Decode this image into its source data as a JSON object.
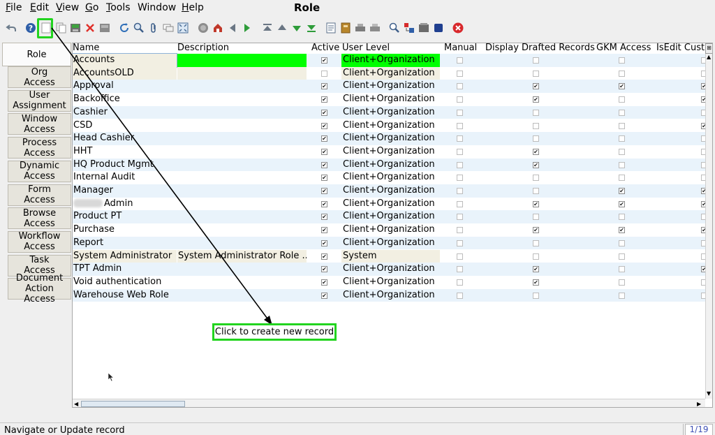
{
  "window_title": "Role",
  "menu": [
    {
      "mn": "F",
      "rest": "ile"
    },
    {
      "mn": "E",
      "rest": "dit"
    },
    {
      "mn": "V",
      "rest": "iew"
    },
    {
      "mn": "G",
      "rest": "o"
    },
    {
      "mn": "T",
      "rest": "ools"
    },
    {
      "mn": "W",
      "rest": "indow",
      "plain": true
    },
    {
      "mn": "H",
      "rest": "elp"
    }
  ],
  "tabs": [
    "Role",
    "Org\nAccess",
    "User\nAssignment",
    "Window\nAccess",
    "Process\nAccess",
    "Dynamic\nAccess",
    "Form\nAccess",
    "Browse\nAccess",
    "Workflow\nAccess",
    "Task\nAccess",
    "Document\nAction Access"
  ],
  "columns": {
    "name": "Name",
    "description": "Description",
    "active": "Active",
    "user_level": "User Level",
    "manual": "Manual",
    "display_drafted": "Display Drafted Records",
    "gkm_access": "GKM Access",
    "isedit": "IsEdit Custo"
  },
  "rows": [
    {
      "name": "Accounts",
      "description": "",
      "active": true,
      "user_level": "Client+Organization",
      "manual": false,
      "drafted": false,
      "gkm": false,
      "isedit": false,
      "selected": true
    },
    {
      "name": "AccountsOLD",
      "description": "",
      "active": false,
      "user_level": "Client+Organization",
      "manual": false,
      "drafted": false,
      "gkm": false,
      "isedit": false
    },
    {
      "name": "Approval",
      "description": "",
      "active": true,
      "user_level": "Client+Organization",
      "manual": false,
      "drafted": true,
      "gkm": true,
      "isedit": true
    },
    {
      "name": "Backoffice",
      "description": "",
      "active": true,
      "user_level": "Client+Organization",
      "manual": false,
      "drafted": true,
      "gkm": false,
      "isedit": true
    },
    {
      "name": "Cashier",
      "description": "",
      "active": true,
      "user_level": "Client+Organization",
      "manual": false,
      "drafted": false,
      "gkm": false,
      "isedit": false
    },
    {
      "name": "CSD",
      "description": "",
      "active": true,
      "user_level": "Client+Organization",
      "manual": false,
      "drafted": false,
      "gkm": false,
      "isedit": true
    },
    {
      "name": "Head Cashier",
      "description": "",
      "active": true,
      "user_level": "Client+Organization",
      "manual": false,
      "drafted": false,
      "gkm": false,
      "isedit": false
    },
    {
      "name": "HHT",
      "description": "",
      "active": true,
      "user_level": "Client+Organization",
      "manual": false,
      "drafted": true,
      "gkm": false,
      "isedit": false
    },
    {
      "name": "HQ Product Mgmt",
      "description": "",
      "active": true,
      "user_level": "Client+Organization",
      "manual": false,
      "drafted": true,
      "gkm": false,
      "isedit": false
    },
    {
      "name": "Internal Audit",
      "description": "",
      "active": true,
      "user_level": "Client+Organization",
      "manual": false,
      "drafted": false,
      "gkm": false,
      "isedit": false
    },
    {
      "name": "Manager",
      "description": "",
      "active": true,
      "user_level": "Client+Organization",
      "manual": false,
      "drafted": false,
      "gkm": true,
      "isedit": true
    },
    {
      "name": "Admin",
      "description": "",
      "active": true,
      "user_level": "Client+Organization",
      "manual": false,
      "drafted": true,
      "gkm": true,
      "isedit": true,
      "blurred_prefix": true
    },
    {
      "name": "Product PT",
      "description": "",
      "active": true,
      "user_level": "Client+Organization",
      "manual": false,
      "drafted": false,
      "gkm": false,
      "isedit": false
    },
    {
      "name": "Purchase",
      "description": "",
      "active": true,
      "user_level": "Client+Organization",
      "manual": false,
      "drafted": true,
      "gkm": true,
      "isedit": true
    },
    {
      "name": "Report",
      "description": "",
      "active": true,
      "user_level": "Client+Organization",
      "manual": false,
      "drafted": false,
      "gkm": false,
      "isedit": false
    },
    {
      "name": "System Administrator",
      "description": "System Administrator Role ...",
      "active": true,
      "user_level": "System",
      "manual": false,
      "drafted": false,
      "gkm": false,
      "isedit": false
    },
    {
      "name": "TPT Admin",
      "description": "",
      "active": true,
      "user_level": "Client+Organization",
      "manual": false,
      "drafted": true,
      "gkm": false,
      "isedit": true
    },
    {
      "name": "Void authentication",
      "description": "",
      "active": true,
      "user_level": "Client+Organization",
      "manual": false,
      "drafted": true,
      "gkm": false,
      "isedit": false
    },
    {
      "name": "Warehouse Web Role",
      "description": "",
      "active": true,
      "user_level": "Client+Organization",
      "manual": false,
      "drafted": false,
      "gkm": false,
      "isedit": false
    }
  ],
  "callout": "Click to create new record",
  "status": {
    "message": "Navigate or Update record",
    "record_count": "1/19"
  },
  "colors": {
    "highlight_green": "#22d41f",
    "required_field": "#00ff00",
    "readonly_field": "#f2efe2",
    "alt_row": "#e9f3fb"
  },
  "toolbar_icons": [
    "undo-icon",
    "help-icon",
    "new-record-icon",
    "copy-record-icon",
    "save-icon",
    "delete-icon",
    "save-disabled-icon",
    "refresh-icon",
    "find-icon",
    "attachment-icon",
    "chat-icon",
    "grid-toggle-icon",
    "history-icon",
    "home-icon",
    "back-icon",
    "forward-icon",
    "first-record-icon",
    "previous-record-icon",
    "next-record-icon",
    "last-record-icon",
    "report-icon",
    "archive-icon",
    "print-icon",
    "print-preview-icon",
    "zoom-across-icon",
    "request-icon",
    "product-info-icon",
    "workflow-icon",
    "close-window-icon"
  ]
}
